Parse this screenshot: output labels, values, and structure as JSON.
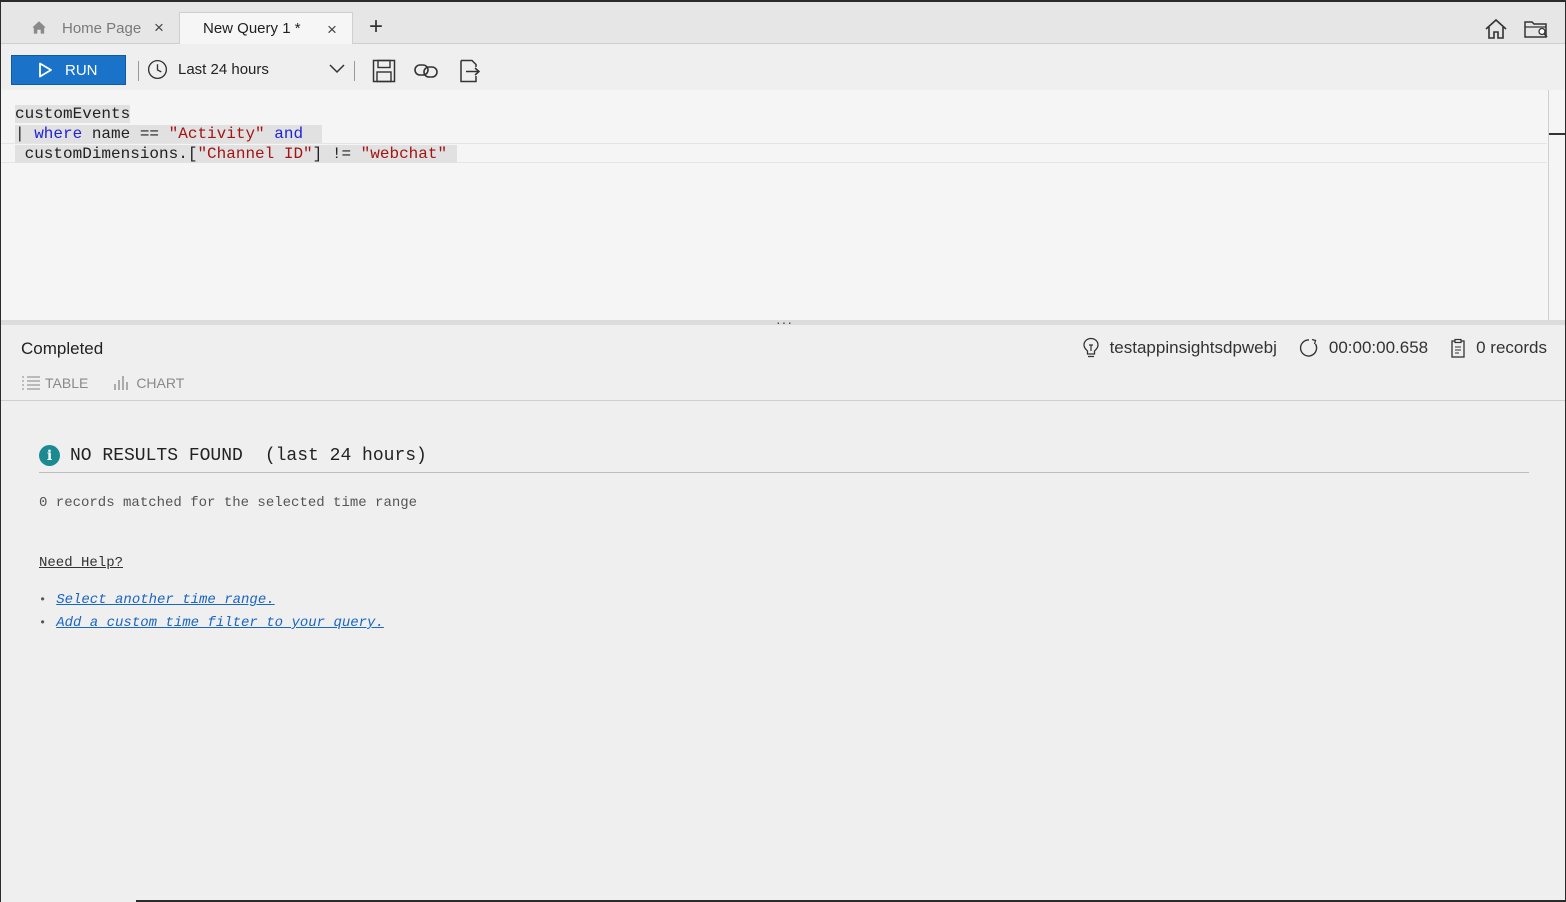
{
  "tabs": {
    "home_label": "Home Page",
    "active_label": "New Query 1 *",
    "close_glyph": "×",
    "add_glyph": "+"
  },
  "toolbar": {
    "run_label": "RUN",
    "time_range": "Last 24 hours"
  },
  "editor": {
    "line1": "customEvents",
    "line2_pipe": "| ",
    "line2_kw1": "where",
    "line2_mid": " name == ",
    "line2_str": "\"Activity\"",
    "line2_sp": " ",
    "line2_kw2": "and",
    "line3_pre": " customDimensions.[",
    "line3_str1": "\"Channel ID\"",
    "line3_mid": "] != ",
    "line3_str2": "\"webchat\""
  },
  "results": {
    "status": "Completed",
    "resource": "testappinsightsdpwebj",
    "duration": "00:00:00.658",
    "records": "0 records",
    "tab_table": "TABLE",
    "tab_chart": "CHART",
    "splitter": "···"
  },
  "no_results": {
    "title": "NO RESULTS FOUND",
    "title_suffix": "(last 24 hours)",
    "info_glyph": "i",
    "subtitle": "0 records matched for the selected time range",
    "help_heading": "Need Help?",
    "bullet": "•",
    "links": [
      "Select another time range.",
      "Add a custom time filter to your query."
    ]
  },
  "colors": {
    "run_button": "#1a73c8",
    "keyword": "#1f23d6",
    "string": "#a31515",
    "info": "#1c8a91",
    "link": "#1a66c2"
  },
  "icons": [
    "home-icon",
    "close-icon",
    "plus-icon",
    "folder-icon",
    "play-icon",
    "clock-icon",
    "chevron-down-icon",
    "save-icon",
    "link-icon",
    "export-icon",
    "lightbulb-icon",
    "timer-icon",
    "clipboard-icon",
    "table-icon",
    "chart-icon",
    "info-icon"
  ]
}
